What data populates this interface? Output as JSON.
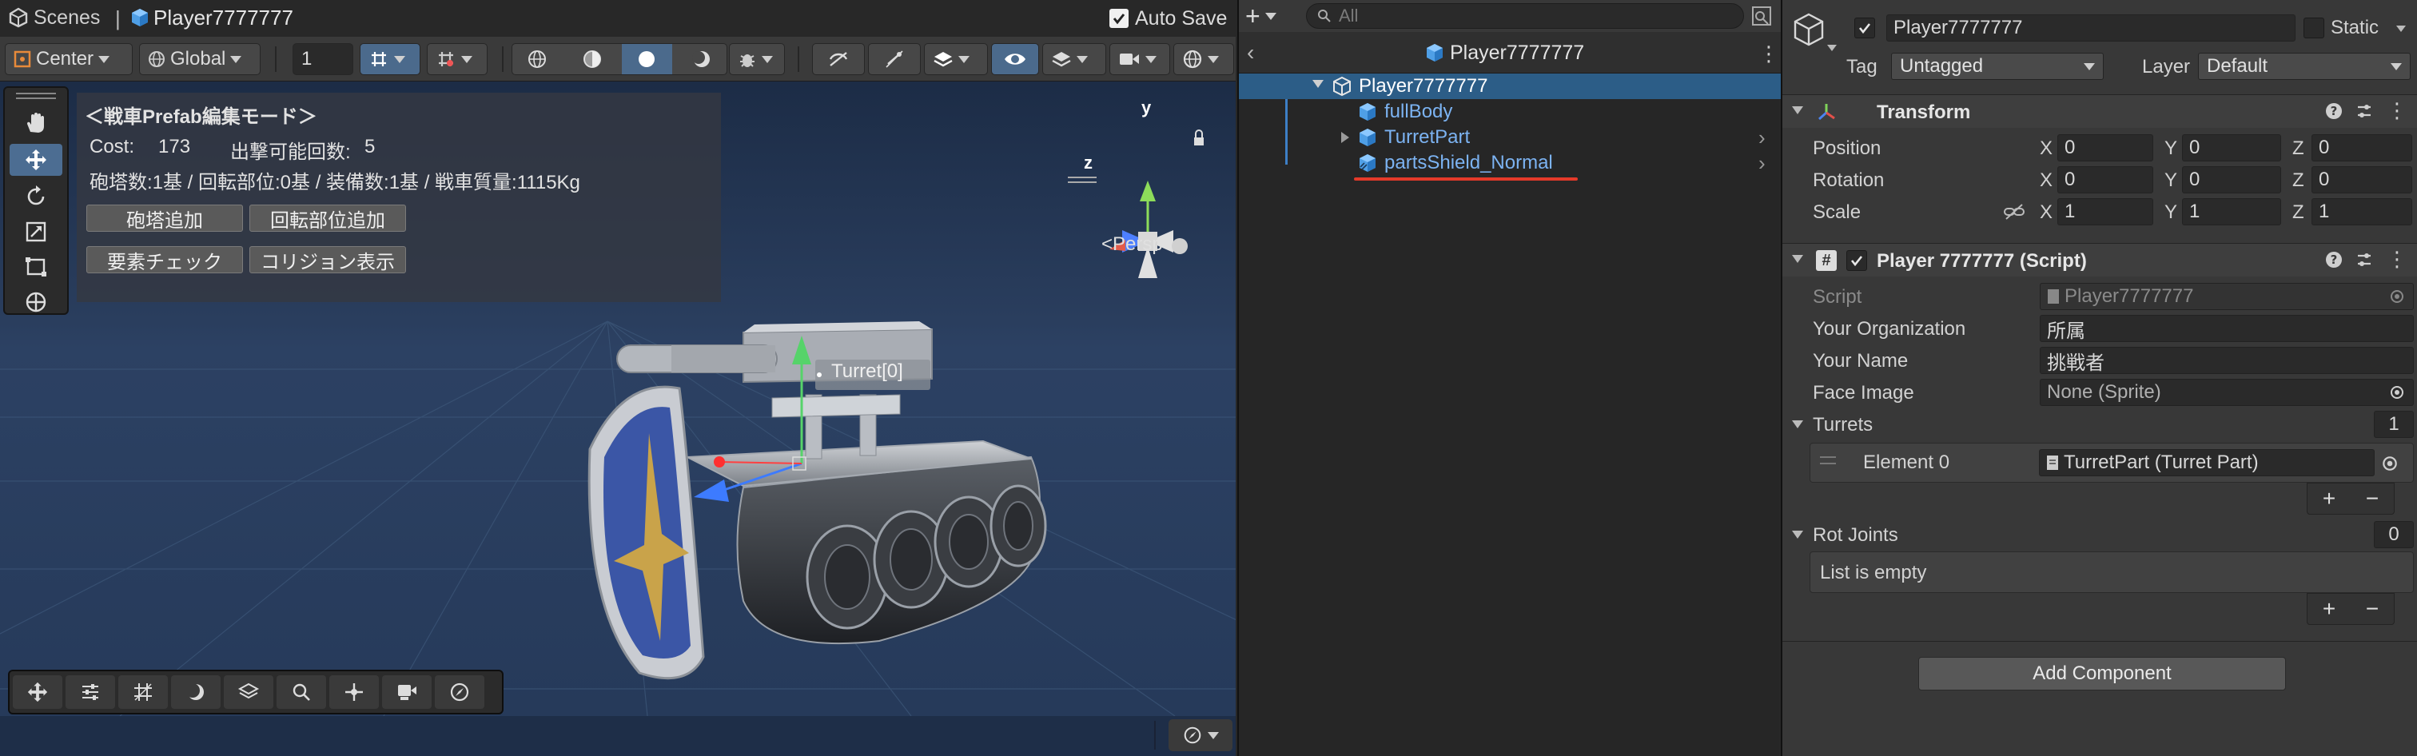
{
  "scene": {
    "tab": {
      "scenes_label": "Scenes",
      "object_label": "Player7777777",
      "autosave_label": "Auto Save"
    },
    "toolbar": {
      "pivot_label": "Center",
      "space_label": "Global",
      "grid_value": "1"
    },
    "prefab_panel": {
      "title": "＜戦車Prefab編集モード＞",
      "cost_label": "Cost:",
      "cost_value": "173",
      "sortie_label": "出撃可能回数:",
      "sortie_value": "5",
      "summary": "砲塔数:1基 / 回転部位:0基 / 装備数:1基 / 戦車質量:1115Kg",
      "btn_add_turret": "砲塔追加",
      "btn_add_rotary": "回転部位追加",
      "btn_check": "要素チェック",
      "btn_collision": "コリジョン表示"
    },
    "turret_label": "Turret[0]",
    "gizmo": {
      "y": "y",
      "z": "z",
      "persp": "Persp"
    }
  },
  "hierarchy": {
    "search_placeholder": "All",
    "header_title": "Player7777777",
    "items": [
      {
        "label": "Player7777777",
        "selected": true
      },
      {
        "label": "fullBody"
      },
      {
        "label": "TurretPart"
      },
      {
        "label": "partsShield_Normal"
      }
    ]
  },
  "inspector": {
    "object_name": "Player7777777",
    "static_label": "Static",
    "tag_label": "Tag",
    "tag_value": "Untagged",
    "layer_label": "Layer",
    "layer_value": "Default",
    "transform": {
      "title": "Transform",
      "position_label": "Position",
      "rotation_label": "Rotation",
      "scale_label": "Scale",
      "axis_x": "X",
      "axis_y": "Y",
      "axis_z": "Z",
      "position": [
        "0",
        "0",
        "0"
      ],
      "rotation": [
        "0",
        "0",
        "0"
      ],
      "scale": [
        "1",
        "1",
        "1"
      ]
    },
    "script_comp": {
      "title": "Player 7777777 (Script)",
      "script_label": "Script",
      "script_value": "Player7777777",
      "org_label": "Your Organization",
      "org_value": "所属",
      "name_label": "Your Name",
      "name_value": "挑戦者",
      "face_label": "Face Image",
      "face_value": "None (Sprite)",
      "turrets_label": "Turrets",
      "turrets_count": "1",
      "element_label": "Element 0",
      "element_value": "TurretPart (Turret Part)",
      "rot_label": "Rot Joints",
      "rot_count": "0",
      "list_empty": "List is empty",
      "plus": "+",
      "minus": "−"
    },
    "add_component": "Add Component"
  }
}
